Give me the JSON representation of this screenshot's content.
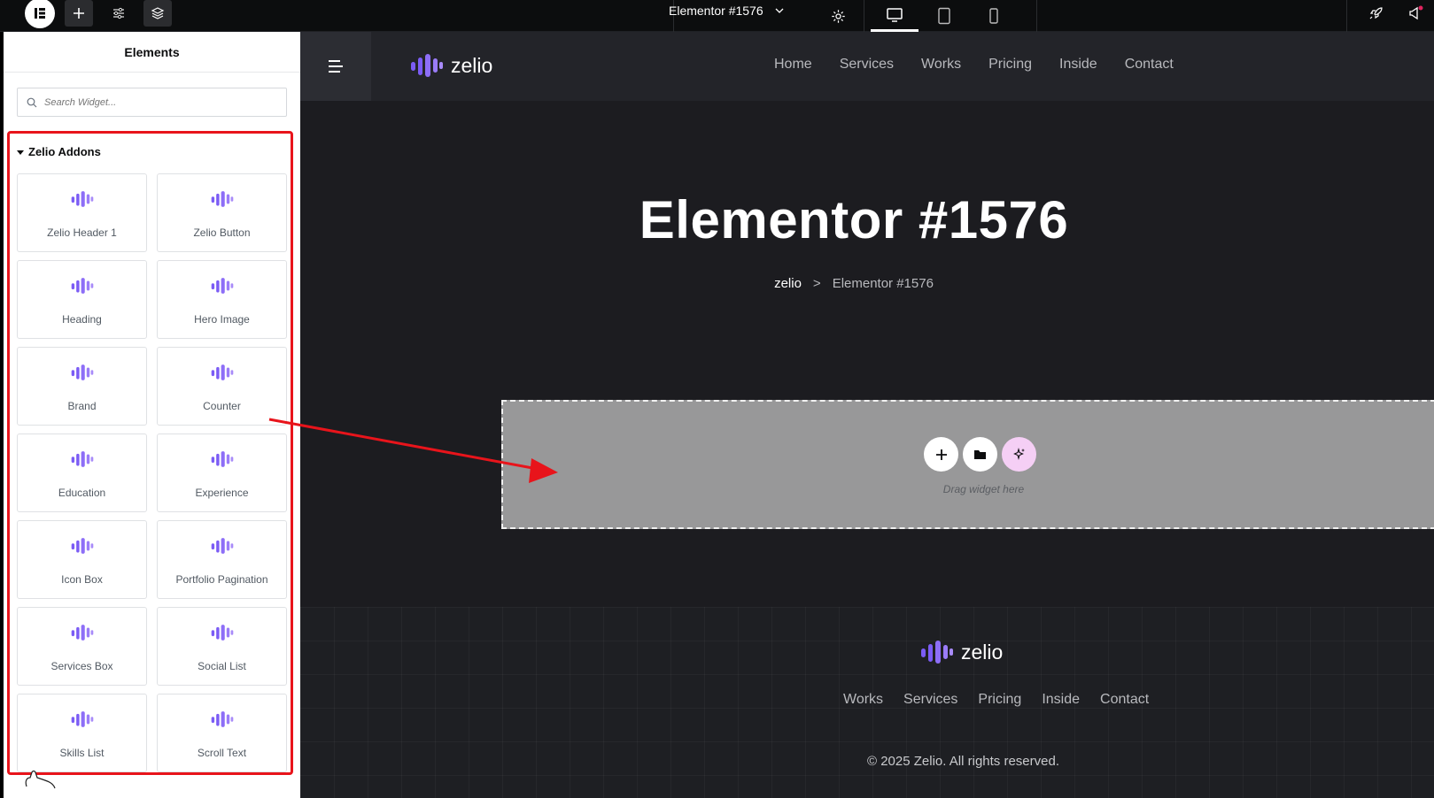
{
  "topbar": {
    "document_title": "Elementor #1576",
    "devices": [
      "desktop",
      "tablet",
      "mobile"
    ]
  },
  "panel": {
    "title": "Elements",
    "search_placeholder": "Search Widget...",
    "category": "Zelio Addons",
    "widgets": [
      {
        "label": "Zelio Header 1"
      },
      {
        "label": "Zelio Button"
      },
      {
        "label": "Heading"
      },
      {
        "label": "Hero Image"
      },
      {
        "label": "Brand"
      },
      {
        "label": "Counter"
      },
      {
        "label": "Education"
      },
      {
        "label": "Experience"
      },
      {
        "label": "Icon Box"
      },
      {
        "label": "Portfolio Pagination"
      },
      {
        "label": "Services Box"
      },
      {
        "label": "Social List"
      },
      {
        "label": "Skills List"
      },
      {
        "label": "Scroll Text"
      }
    ]
  },
  "site": {
    "logo_text": "zelio",
    "nav": [
      "Home",
      "Services",
      "Works",
      "Pricing",
      "Inside",
      "Contact"
    ],
    "page_title": "Elementor #1576",
    "breadcrumb": {
      "home": "zelio",
      "separator": ">",
      "current": "Elementor #1576"
    },
    "drop_hint": "Drag widget here",
    "footer": {
      "logo_text": "zelio",
      "nav": [
        "Works",
        "Services",
        "Pricing",
        "Inside",
        "Contact"
      ],
      "copyright": "© 2025 Zelio. All rights reserved."
    }
  },
  "colors": {
    "brand_purple": "#7b5cf5",
    "annotation_red": "#e8141b",
    "canvas_bg": "#1c1c20"
  }
}
